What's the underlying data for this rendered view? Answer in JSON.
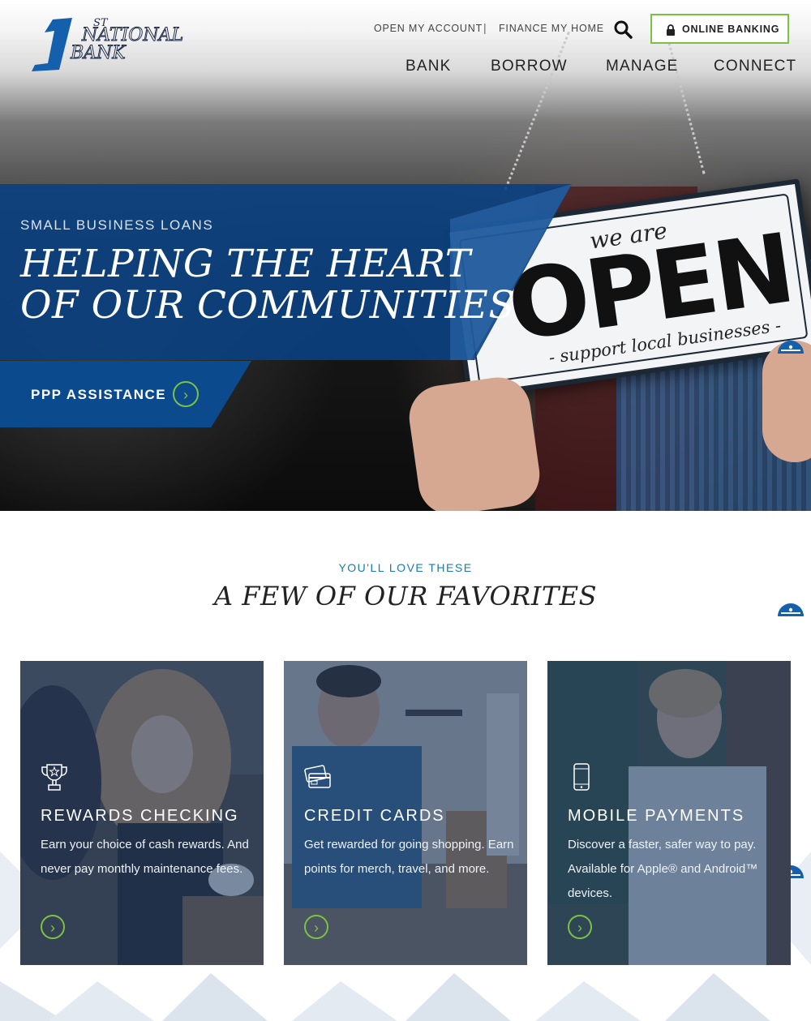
{
  "header": {
    "logo_text": {
      "number": "1",
      "suffix": "ST",
      "line1": "NATIONAL",
      "line2": "BANK"
    },
    "utility_links": [
      "OPEN MY ACCOUNT",
      "|",
      "FINANCE MY HOME"
    ],
    "search_icon": "search-icon",
    "online_banking_label": "ONLINE BANKING",
    "nav": [
      "BANK",
      "BORROW",
      "MANAGE",
      "CONNECT"
    ]
  },
  "hero": {
    "kicker": "SMALL BUSINESS LOANS",
    "title_line1": "HELPING THE HEART",
    "title_line2": "OF OUR COMMUNITIES",
    "cta_label": "PPP ASSISTANCE",
    "sign": {
      "we_are": "we are",
      "open": "OPEN",
      "support": "- support local businesses -"
    }
  },
  "favorites": {
    "kicker": "YOU'LL LOVE THESE",
    "title": "A FEW OF OUR FAVORITES",
    "cards": [
      {
        "icon": "trophy-icon",
        "title": "REWARDS CHECKING",
        "desc": "Earn your choice of cash rewards. And never pay monthly maintenance fees."
      },
      {
        "icon": "credit-card-icon",
        "title": "CREDIT CARDS",
        "desc": "Get rewarded for going shopping. Earn points for merch, travel, and more."
      },
      {
        "icon": "mobile-phone-icon",
        "title": "MOBILE PAYMENTS",
        "desc": "Discover a faster, safer way to pay. Available for Apple® and Android™ devices."
      }
    ]
  },
  "colors": {
    "brand_blue": "#0b4a8c",
    "accent_green": "#7cc242",
    "kicker_teal": "#1d7aa8"
  }
}
